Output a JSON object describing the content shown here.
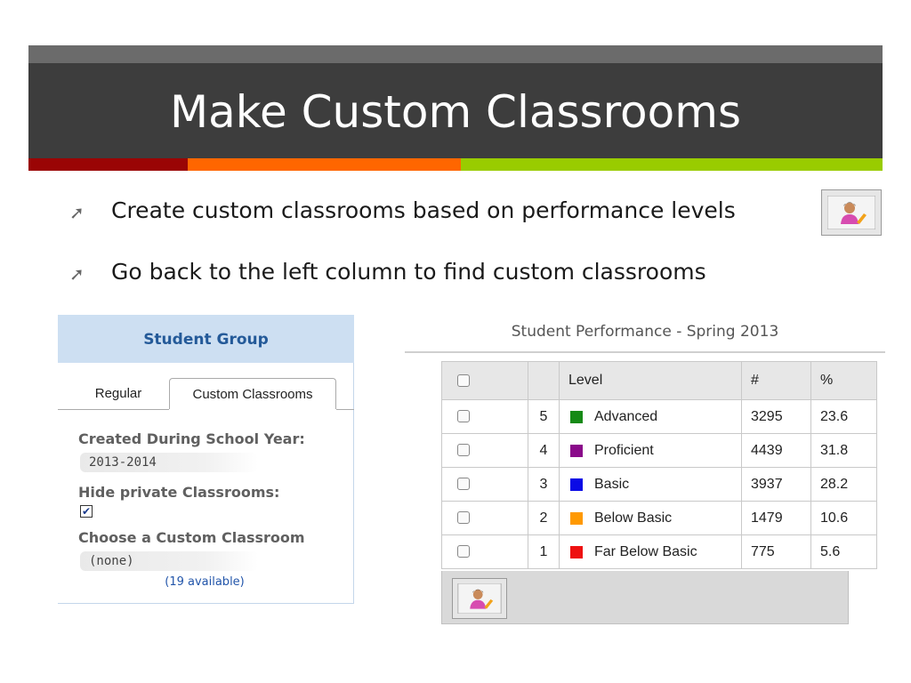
{
  "slide": {
    "title": "Make Custom Classrooms",
    "bullets": [
      "Create custom classrooms based on performance levels",
      "Go back to the left column to find custom classrooms"
    ],
    "icons": {
      "bullet": "arrow-up-right-icon",
      "person": "person-pencil-icon"
    }
  },
  "student_group": {
    "title": "Student Group",
    "tabs": [
      "Regular",
      "Custom Classrooms"
    ],
    "active_tab": "Custom Classrooms",
    "school_year_label": "Created During School Year:",
    "school_year_value": "2013-2014",
    "hide_private_label": "Hide private Classrooms:",
    "hide_private_checked": true,
    "choose_label": "Choose a Custom Classroom",
    "choose_value": "(none)",
    "available": "(19 available)"
  },
  "performance": {
    "title": "Student Performance - Spring 2013",
    "headers": {
      "level": "Level",
      "count": "#",
      "percent": "%"
    },
    "rows": [
      {
        "num": "5",
        "level": "Advanced",
        "count": "3295",
        "percent": "23.6",
        "color": "#168a16"
      },
      {
        "num": "4",
        "level": "Proficient",
        "count": "4439",
        "percent": "31.8",
        "color": "#8a0a8a"
      },
      {
        "num": "3",
        "level": "Basic",
        "count": "3937",
        "percent": "28.2",
        "color": "#0a0ae6"
      },
      {
        "num": "2",
        "level": "Below Basic",
        "count": "1479",
        "percent": "10.6",
        "color": "#ff9900"
      },
      {
        "num": "1",
        "level": "Far Below Basic",
        "count": "775",
        "percent": "5.6",
        "color": "#ee1111"
      }
    ]
  },
  "colors": {
    "header_bg": "#3d3d3d",
    "accent_red": "#9a0505",
    "accent_orange": "#ff6600",
    "accent_green": "#99cc00",
    "panel_header": "#cddff2",
    "panel_title": "#245a99"
  }
}
